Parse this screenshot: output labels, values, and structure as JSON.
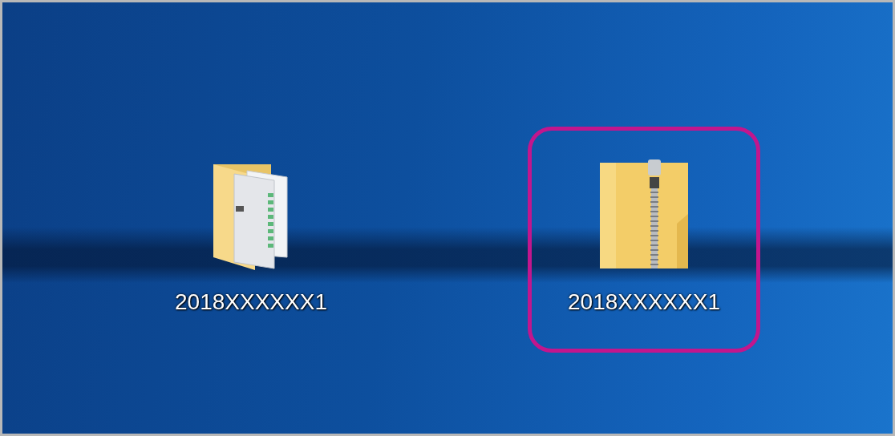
{
  "desktop": {
    "items": [
      {
        "kind": "folder",
        "label": "2018XXXXXX1",
        "highlighted": false
      },
      {
        "kind": "zip",
        "label": "2018XXXXXX1",
        "highlighted": true
      }
    ]
  }
}
